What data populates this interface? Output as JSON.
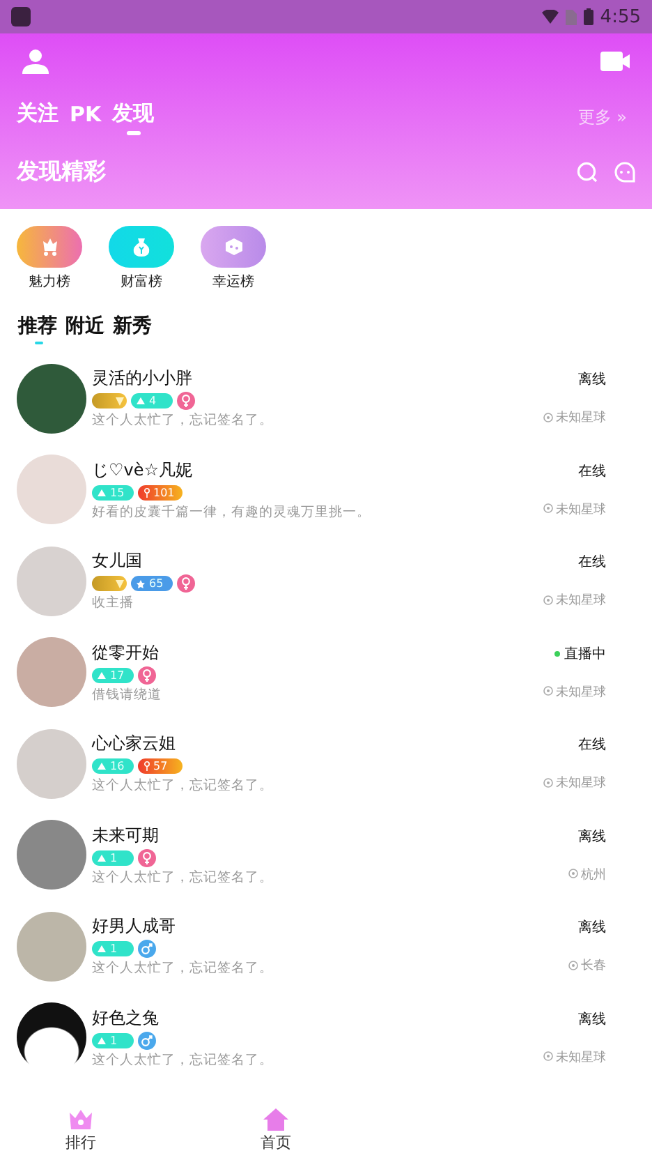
{
  "status_bar": {
    "time": "4:55"
  },
  "top_tabs": [
    {
      "label": "关注",
      "selected": false
    },
    {
      "label": "PK",
      "selected": false
    },
    {
      "label": "发现",
      "selected": true
    }
  ],
  "more_link": "更多 »",
  "section_title": "发现精彩",
  "rankings": [
    {
      "kind": "charm",
      "label": "魅力榜"
    },
    {
      "kind": "wealth",
      "label": "财富榜"
    },
    {
      "kind": "luck",
      "label": "幸运榜"
    }
  ],
  "sub_tabs": [
    {
      "label": "推荐",
      "selected": true
    },
    {
      "label": "附近",
      "selected": false
    },
    {
      "label": "新秀",
      "selected": false
    }
  ],
  "users": [
    {
      "name": "灵活的小小胖",
      "badges": [
        {
          "kind": "vip"
        },
        {
          "kind": "level",
          "text": "4"
        },
        {
          "kind": "female"
        }
      ],
      "bio": "这个人太忙了，忘记签名了。",
      "status": "离线",
      "live": false,
      "location": "未知星球"
    },
    {
      "name": "じ♡vè☆凡妮",
      "badges": [
        {
          "kind": "level",
          "text": "15"
        },
        {
          "kind": "charm",
          "text": "101"
        }
      ],
      "bio": "好看的皮囊千篇一律，有趣的灵魂万里挑一。",
      "status": "在线",
      "live": false,
      "location": "未知星球"
    },
    {
      "name": "女儿国",
      "badges": [
        {
          "kind": "vip"
        },
        {
          "kind": "star_level",
          "text": "65"
        },
        {
          "kind": "female"
        }
      ],
      "bio": "收主播",
      "status": "在线",
      "live": false,
      "location": "未知星球"
    },
    {
      "name": "從零开始",
      "badges": [
        {
          "kind": "level",
          "text": "17"
        },
        {
          "kind": "female"
        }
      ],
      "bio": "借钱请绕道",
      "status": "直播中",
      "live": true,
      "location": "未知星球"
    },
    {
      "name": "心心家云姐",
      "badges": [
        {
          "kind": "level",
          "text": "16"
        },
        {
          "kind": "charm",
          "text": "57"
        }
      ],
      "bio": "这个人太忙了，忘记签名了。",
      "status": "在线",
      "live": false,
      "location": "未知星球"
    },
    {
      "name": "未来可期",
      "badges": [
        {
          "kind": "level",
          "text": "1"
        },
        {
          "kind": "female"
        }
      ],
      "bio": "这个人太忙了，忘记签名了。",
      "status": "离线",
      "live": false,
      "location": "杭州"
    },
    {
      "name": "好男人成哥",
      "badges": [
        {
          "kind": "level",
          "text": "1"
        },
        {
          "kind": "male"
        }
      ],
      "bio": "这个人太忙了，忘记签名了。",
      "status": "离线",
      "live": false,
      "location": "长春"
    },
    {
      "name": "好色之兔",
      "badges": [
        {
          "kind": "level",
          "text": "1"
        },
        {
          "kind": "male"
        }
      ],
      "bio": "这个人太忙了，忘记签名了。",
      "status": "离线",
      "live": false,
      "location": "未知星球"
    }
  ],
  "bottom_nav": [
    {
      "kind": "crown",
      "label": "排行"
    },
    {
      "kind": "home",
      "label": "首页"
    }
  ]
}
